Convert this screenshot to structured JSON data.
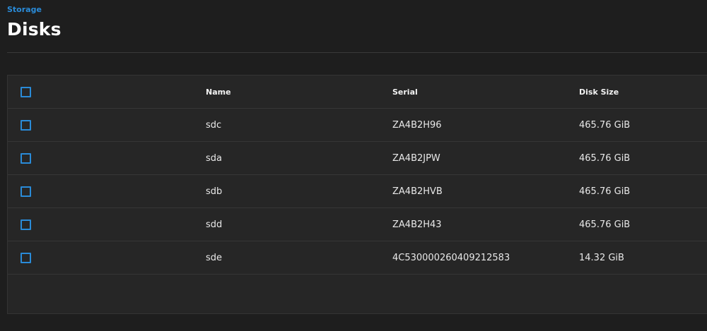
{
  "breadcrumb": {
    "label": "Storage"
  },
  "page": {
    "title": "Disks"
  },
  "table": {
    "columns": {
      "name": "Name",
      "serial": "Serial",
      "size": "Disk Size"
    },
    "rows": [
      {
        "name": "sdc",
        "serial": "ZA4B2H96",
        "size": "465.76 GiB"
      },
      {
        "name": "sda",
        "serial": "ZA4B2JPW",
        "size": "465.76 GiB"
      },
      {
        "name": "sdb",
        "serial": "ZA4B2HVB",
        "size": "465.76 GiB"
      },
      {
        "name": "sdd",
        "serial": "ZA4B2H43",
        "size": "465.76 GiB"
      },
      {
        "name": "sde",
        "serial": "4C530000260409212583",
        "size": "14.32 GiB"
      }
    ]
  },
  "colors": {
    "accent": "#2a8bd8",
    "background": "#1e1e1e",
    "card": "#262626"
  }
}
